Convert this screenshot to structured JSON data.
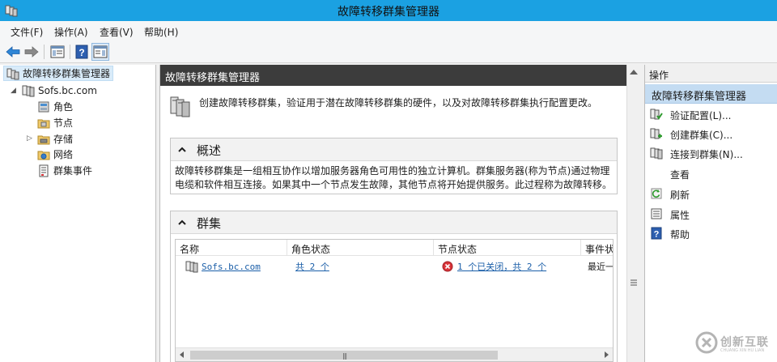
{
  "window": {
    "title": "故障转移群集管理器"
  },
  "menu": [
    "文件(F)",
    "操作(A)",
    "查看(V)",
    "帮助(H)"
  ],
  "toolbar": {
    "icons": [
      "back-icon",
      "forward-icon",
      "show-tree-icon",
      "help-icon",
      "show-action-pane-icon"
    ]
  },
  "tree": {
    "root": "故障转移群集管理器",
    "cluster": "Sofs.bc.com",
    "children": [
      "角色",
      "节点",
      "存储",
      "网络",
      "群集事件"
    ]
  },
  "center": {
    "header": "故障转移群集管理器",
    "intro": "创建故障转移群集，验证用于潜在故障转移群集的硬件，以及对故障转移群集执行配置更改。",
    "overview": {
      "title": "概述",
      "line1": "故障转移群集是一组相互协作以增加服务器角色可用性的独立计算机。群集服务器(称为节点)通过物理",
      "line2": "电缆和软件相互连接。如果其中一个节点发生故障，其他节点将开始提供服务。此过程称为故障转移。"
    },
    "clusters": {
      "title": "群集",
      "columns": [
        "名称",
        "角色状态",
        "节点状态",
        "事件状"
      ],
      "rows": [
        {
          "name": "Sofs.bc.com",
          "role_status": "共 2 个",
          "node_status": "1 个已关闭，共 2 个",
          "events": "最近一"
        }
      ]
    }
  },
  "actions": {
    "header": "操作",
    "group": "故障转移群集管理器",
    "items": [
      {
        "label": "验证配置(L)...",
        "icon": "validate-config-icon"
      },
      {
        "label": "创建群集(C)...",
        "icon": "create-cluster-icon"
      },
      {
        "label": "连接到群集(N)...",
        "icon": "connect-cluster-icon"
      },
      {
        "label": "查看",
        "icon": ""
      },
      {
        "label": "刷新",
        "icon": "refresh-icon"
      },
      {
        "label": "属性",
        "icon": "properties-icon"
      },
      {
        "label": "帮助",
        "icon": "help-icon"
      }
    ]
  },
  "watermark": {
    "text": "创新互联",
    "sub": "CHUANG XIN HU LIAN"
  },
  "colors": {
    "titlebar": "#1ba1e2",
    "center_header": "#3c3c3c",
    "actions_group": "#c4dcf2",
    "link": "#1a5ea8",
    "error": "#d9343a"
  }
}
